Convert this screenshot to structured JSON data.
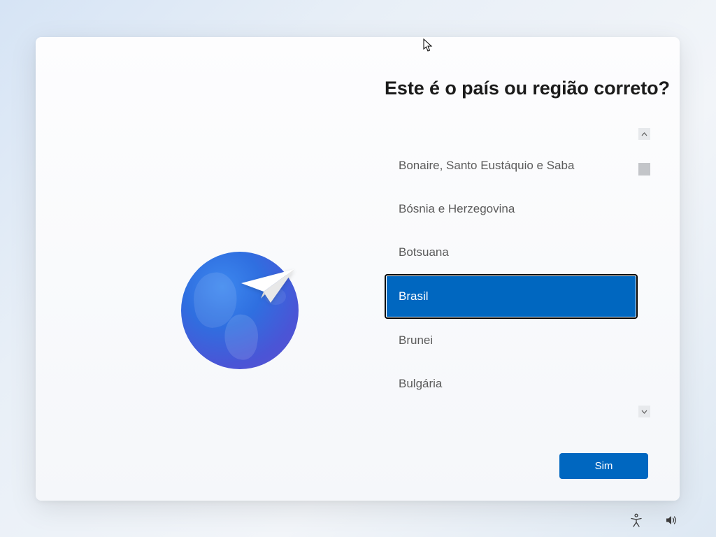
{
  "title": "Este é o país ou região correto?",
  "countries": [
    {
      "label": "Bonaire, Santo Eustáquio e Saba",
      "selected": false
    },
    {
      "label": "Bósnia e Herzegovina",
      "selected": false
    },
    {
      "label": "Botsuana",
      "selected": false
    },
    {
      "label": "Brasil",
      "selected": true
    },
    {
      "label": "Brunei",
      "selected": false
    },
    {
      "label": "Bulgária",
      "selected": false
    }
  ],
  "yes_button": "Sim",
  "icons": {
    "globe": "globe-paperplane-icon",
    "accessibility": "accessibility-icon",
    "volume": "volume-icon",
    "scroll_up": "chevron-up-icon",
    "scroll_down": "chevron-down-icon"
  },
  "colors": {
    "accent": "#0067c0",
    "card_bg": "#fdfdfe",
    "text_primary": "#1b1b1b",
    "text_secondary": "#5b5b5b"
  }
}
